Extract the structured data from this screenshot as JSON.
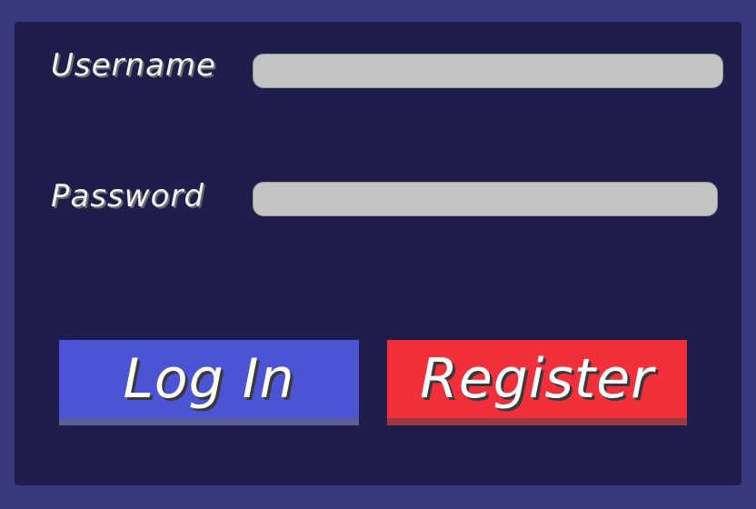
{
  "form": {
    "username_label": "Username",
    "username_value": "",
    "password_label": "Password",
    "password_value": "",
    "login_label": "Log In",
    "register_label": "Register"
  },
  "colors": {
    "outer_frame": "#363a7a",
    "panel_background": "#1f1d4b",
    "input_background": "#c4c4c4",
    "login_button": "#4c53d5",
    "register_button": "#f2303b",
    "label_text": "#f2f2f2"
  }
}
